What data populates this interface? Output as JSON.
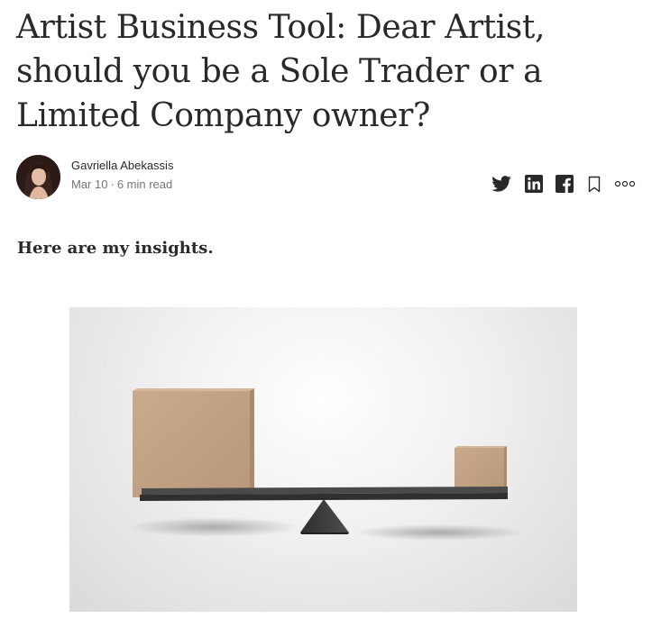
{
  "article": {
    "title": "Artist Business Tool: Dear Artist, should you be a Sole Trader or a Limited Company owner?",
    "author": "Gavriella Abekassis",
    "date": "Mar 10",
    "separator": "·",
    "read_time": "6 min read",
    "intro": "Here are my insights."
  },
  "share": {
    "icons": [
      "twitter-icon",
      "linkedin-icon",
      "facebook-icon",
      "bookmark-icon",
      "more-icon"
    ]
  },
  "colors": {
    "text": "#292929",
    "meta": "#757575",
    "box": "#c2a286",
    "seesaw": "#3d3d3d"
  }
}
